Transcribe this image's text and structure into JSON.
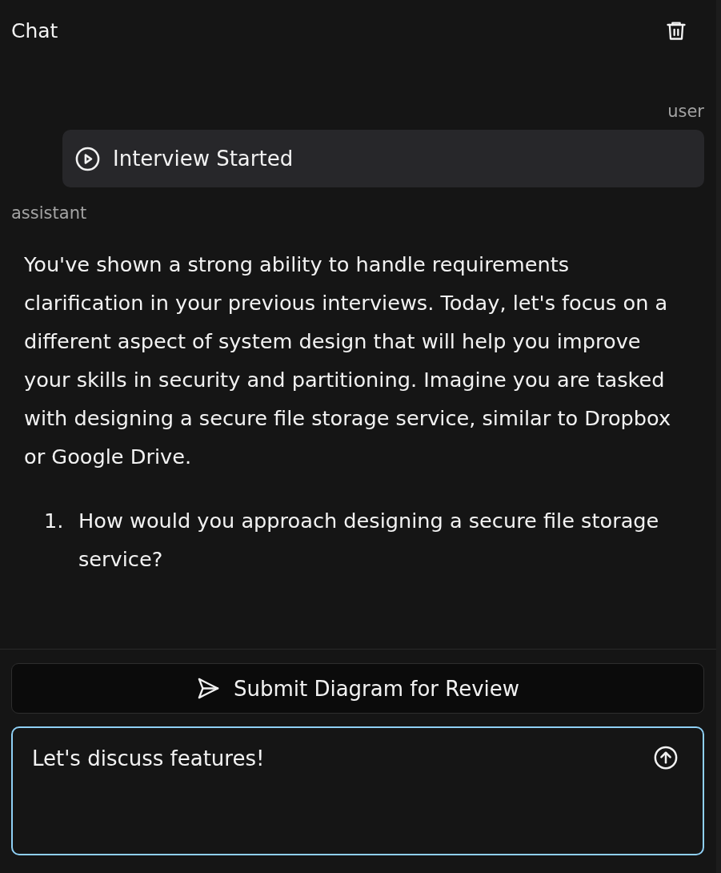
{
  "header": {
    "title": "Chat"
  },
  "messages": [
    {
      "role": "user",
      "kind": "event",
      "text": "Interview Started"
    },
    {
      "role": "assistant",
      "kind": "text",
      "paragraphs": [
        "You've shown a strong ability to handle requirements clarification in your previous interviews. Today, let's focus on a different aspect of system design that will help you improve your skills in security and partitioning. Imagine you are tasked with designing a secure file storage service, similar to Dropbox or Google Drive."
      ],
      "list": [
        {
          "marker": "1.",
          "text": "How would you approach designing a secure file storage service?"
        }
      ]
    }
  ],
  "submit_button": {
    "label": "Submit Diagram for Review"
  },
  "composer": {
    "value": "Let's discuss features!",
    "focused": true
  }
}
